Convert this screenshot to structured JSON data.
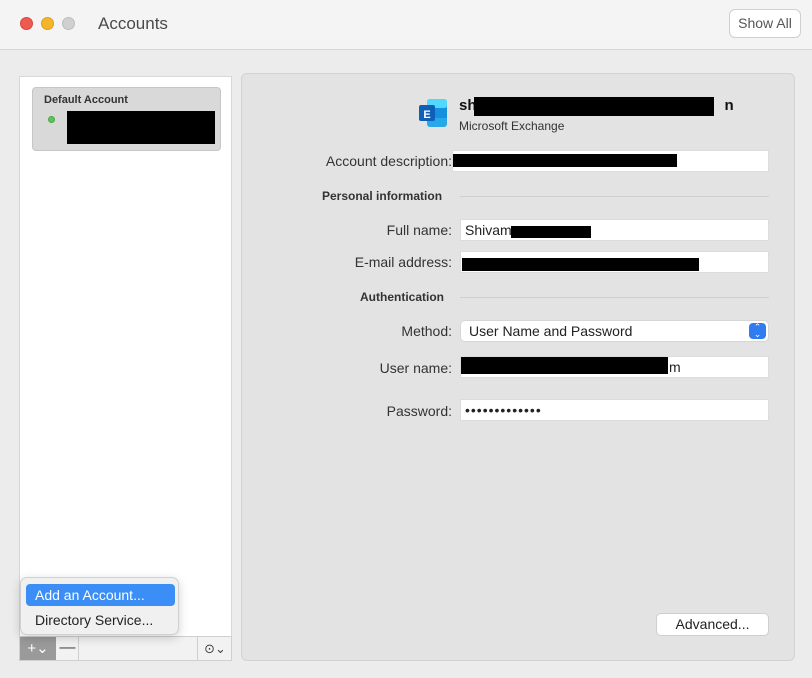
{
  "window": {
    "title": "Accounts",
    "show_all_label": "Show All"
  },
  "sidebar": {
    "default_account_header": "Default Account",
    "account_status": "online"
  },
  "bottom_bar": {
    "add_label": "+⌄",
    "remove_label": "—",
    "action_label": "⊙⌄"
  },
  "popup_menu": {
    "items": [
      {
        "label": "Add an Account...",
        "highlighted": true
      },
      {
        "label": "Directory Service..."
      }
    ]
  },
  "account": {
    "email_heading": "sh",
    "email_tail": "n",
    "provider": "Microsoft Exchange",
    "icon": "exchange-icon"
  },
  "form": {
    "account_description_label": "Account description:",
    "personal_info_header": "Personal information",
    "full_name_label": "Full name:",
    "full_name_value": "Shivam",
    "email_label": "E-mail address:",
    "authentication_header": "Authentication",
    "method_label": "Method:",
    "method_value": "User Name and Password",
    "username_label": "User name:",
    "username_tail": "m",
    "password_label": "Password:",
    "password_value": "•••••••••••••"
  },
  "buttons": {
    "advanced_label": "Advanced..."
  },
  "colors": {
    "accent": "#3a8ef6",
    "exchange_blue": "#1e73c9"
  }
}
